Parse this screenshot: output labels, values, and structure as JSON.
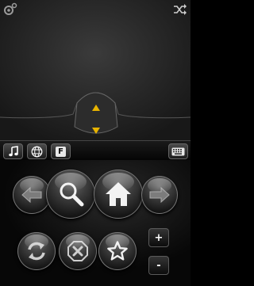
{
  "touchpad": {
    "settings_icon": "gear-icon",
    "shuffle_icon": "shuffle-icon",
    "scroll_up_icon": "triangle-up-icon",
    "scroll_down_icon": "triangle-down-icon",
    "arrow_color": "#e8b400"
  },
  "shortcut_bar": {
    "music_icon": "music-note-icon",
    "web_icon": "globe-icon",
    "fkeys_label": "F",
    "keyboard_icon": "keyboard-icon"
  },
  "remote": {
    "back_icon": "arrow-left-icon",
    "search_icon": "magnifier-icon",
    "home_icon": "house-icon",
    "forward_icon": "arrow-right-icon",
    "refresh_icon": "refresh-icon",
    "stop_icon": "stop-x-icon",
    "favorite_icon": "star-icon",
    "zoom_in_label": "+",
    "zoom_out_label": "-"
  }
}
